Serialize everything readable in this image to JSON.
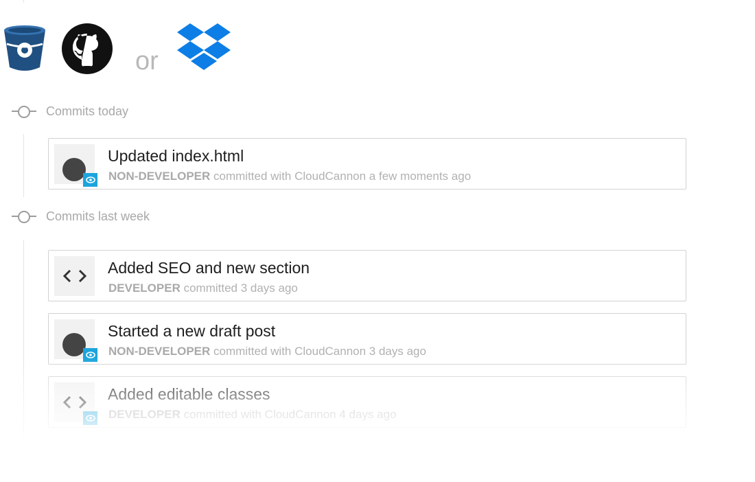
{
  "integrations": {
    "or_label": "or",
    "icons": [
      "bitbucket-icon",
      "github-icon",
      "dropbox-icon"
    ],
    "colors": {
      "bitbucket": "#205081",
      "github": "#111111",
      "dropbox": "#0d7ee6"
    }
  },
  "sections": [
    {
      "title": "Commits today",
      "commits": [
        {
          "message": "Updated index.html",
          "role": "NON-DEVELOPER",
          "detail": " committed with CloudCannon a few moments ago",
          "avatar": "user-avatar-icon"
        }
      ]
    },
    {
      "title": "Commits last week",
      "commits": [
        {
          "message": "Added SEO and new section",
          "role": "DEVELOPER",
          "detail": " committed 3 days ago",
          "avatar": "code-icon"
        },
        {
          "message": "Started a new draft post",
          "role": "NON-DEVELOPER",
          "detail": " committed with CloudCannon 3 days ago",
          "avatar": "user-avatar-icon"
        },
        {
          "message": "Added editable classes",
          "role": "DEVELOPER",
          "detail": " committed with CloudCannon 4 days ago",
          "avatar": "code-icon"
        }
      ]
    }
  ],
  "colors": {
    "cloudcannon_badge": "#1ca4dc"
  }
}
